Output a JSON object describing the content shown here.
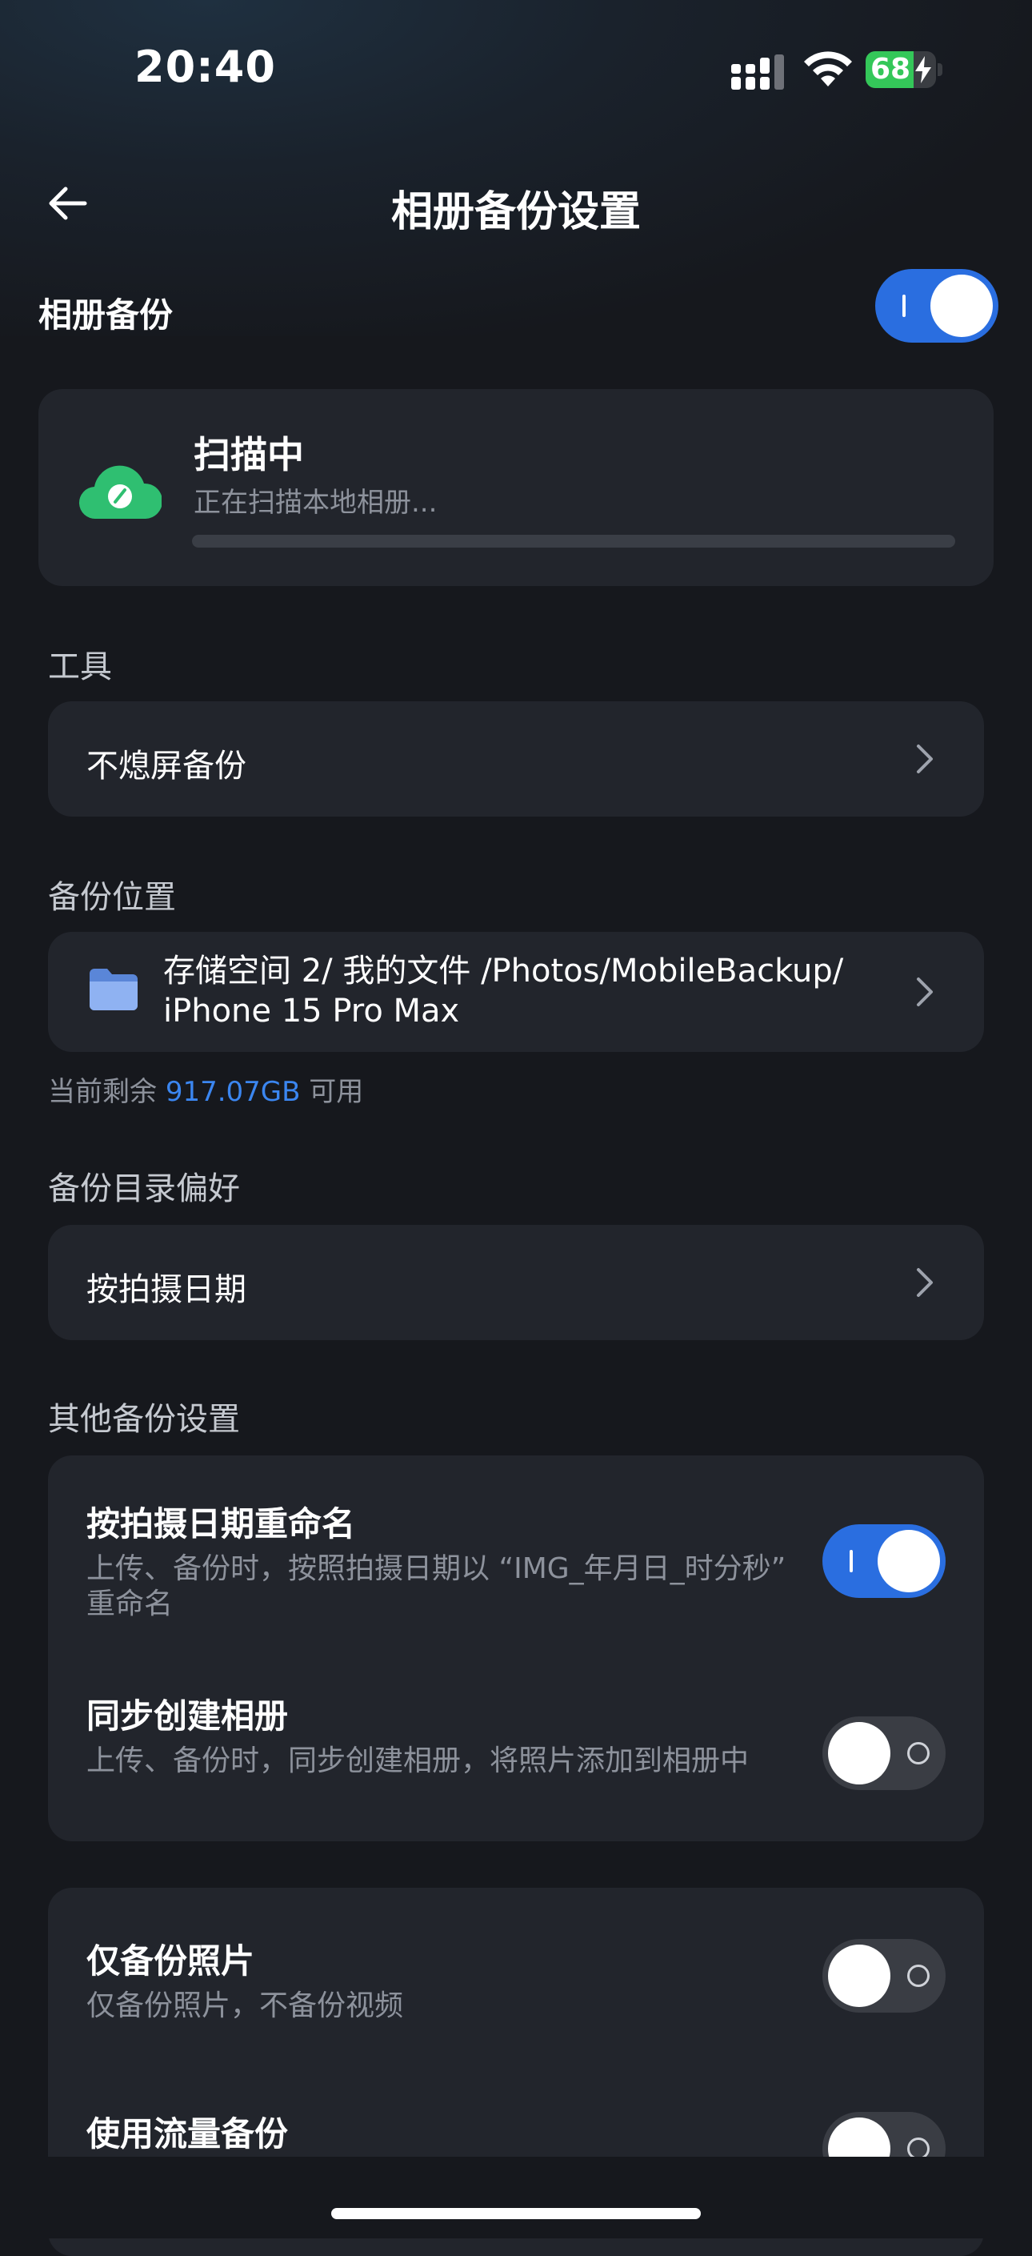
{
  "status_bar": {
    "time": "20:40",
    "battery_level": "68",
    "battery_percent": 68
  },
  "header": {
    "title": "相册备份设置"
  },
  "master": {
    "label": "相册备份",
    "enabled": true
  },
  "scan": {
    "title": "扫描中",
    "subtitle": "正在扫描本地相册...",
    "progress": 0
  },
  "tools": {
    "section_label": "工具",
    "item_label": "不熄屏备份"
  },
  "backup_location": {
    "section_label": "备份位置",
    "path_line1": "存储空间 2/ 我的文件 /Photos/MobileBackup/",
    "path_line2": "iPhone 15 Pro Max",
    "remaining_prefix": "当前剩余",
    "remaining_value": "917.07GB",
    "remaining_suffix": "可用"
  },
  "directory_pref": {
    "section_label": "备份目录偏好",
    "item_label": "按拍摄日期"
  },
  "other_settings": {
    "section_label": "其他备份设置",
    "items": [
      {
        "title": "按拍摄日期重命名",
        "desc": "上传、备份时，按照拍摄日期以 “IMG_年月日_时分秒” 重命名",
        "enabled": true
      },
      {
        "title": "同步创建相册",
        "desc": "上传、备份时，同步创建相册，将照片添加到相册中",
        "enabled": false
      }
    ],
    "items2": [
      {
        "title": "仅备份照片",
        "desc": "仅备份照片，不备份视频",
        "enabled": false
      },
      {
        "title": "使用流量备份",
        "enabled": false
      }
    ]
  },
  "colors": {
    "accent": "#2a6ee0",
    "cloud_green": "#2fbf71",
    "background": "#16181d",
    "card": "#22252c"
  }
}
